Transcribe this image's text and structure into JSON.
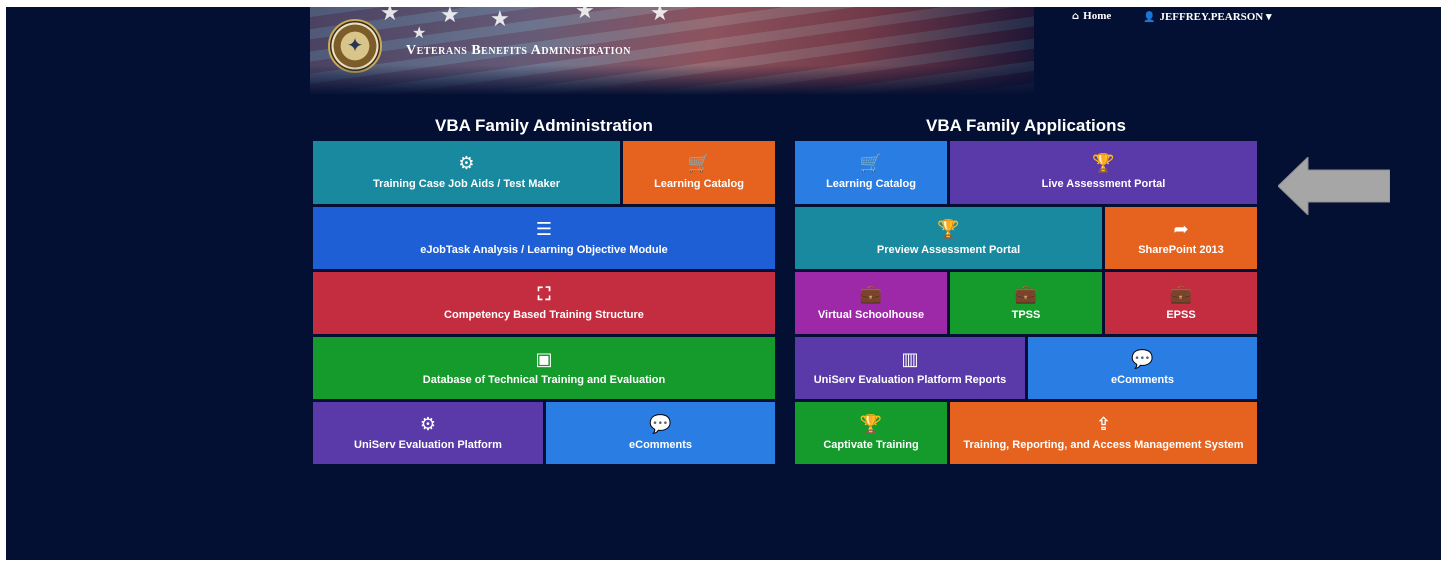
{
  "header": {
    "org_title": "Veterans Benefits Administration",
    "home_label": "Home",
    "user_label": "JEFFREY.PEARSON ▾"
  },
  "admin": {
    "title": "VBA Family Administration",
    "tiles": [
      {
        "label": "Training Case Job Aids / Test Maker",
        "icon": "gears-icon",
        "color": "#18899e"
      },
      {
        "label": "Learning Catalog",
        "icon": "cart-icon",
        "color": "#e5631f"
      },
      {
        "label": "eJobTask Analysis / Learning Objective Module",
        "icon": "server-icon",
        "color": "#1e5fd6"
      },
      {
        "label": "Competency Based Training Structure",
        "icon": "sitemap-icon",
        "color": "#c42c40"
      },
      {
        "label": "Database of Technical Training and Evaluation",
        "icon": "archive-icon",
        "color": "#159a2c"
      },
      {
        "label": "UniServ Evaluation Platform",
        "icon": "gears-icon",
        "color": "#5a3aa8"
      },
      {
        "label": "eComments",
        "icon": "comment-icon",
        "color": "#2a7de3"
      }
    ]
  },
  "apps": {
    "title": "VBA Family Applications",
    "tiles": [
      {
        "label": "Learning Catalog",
        "icon": "cart-icon",
        "color": "#2a7de3"
      },
      {
        "label": "Live Assessment Portal",
        "icon": "trophy-icon",
        "color": "#5a3aa8"
      },
      {
        "label": "Preview Assessment Portal",
        "icon": "trophy-icon",
        "color": "#18899e"
      },
      {
        "label": "SharePoint 2013",
        "icon": "share-icon",
        "color": "#e5631f"
      },
      {
        "label": "Virtual Schoolhouse",
        "icon": "briefcase-icon",
        "color": "#9d29a9"
      },
      {
        "label": "TPSS",
        "icon": "briefcase-icon",
        "color": "#159a2c"
      },
      {
        "label": "EPSS",
        "icon": "briefcase-icon",
        "color": "#c42c40"
      },
      {
        "label": "UniServ Evaluation Platform Reports",
        "icon": "bar-chart-icon",
        "color": "#5a3aa8"
      },
      {
        "label": "eComments",
        "icon": "comment-icon",
        "color": "#2a7de3"
      },
      {
        "label": "Captivate Training",
        "icon": "trophy-icon",
        "color": "#159a2c"
      },
      {
        "label": "Training, Reporting, and Access Management System",
        "icon": "upload-icon",
        "color": "#e5631f"
      }
    ]
  },
  "colors": {
    "background": "#041033",
    "arrow": "#a6a6a6"
  }
}
